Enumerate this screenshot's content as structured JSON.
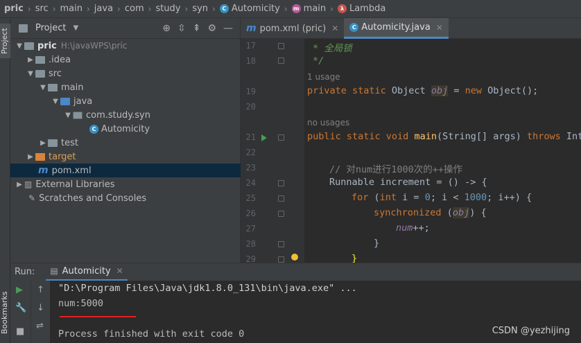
{
  "breadcrumb": {
    "items": [
      "pric",
      "src",
      "main",
      "java",
      "com",
      "study",
      "syn",
      "Automicity",
      "main",
      "Lambda"
    ]
  },
  "left_strip": {
    "project_tab": "Project",
    "bookmarks_tab": "Bookmarks"
  },
  "project_panel": {
    "title": "Project",
    "tree": [
      {
        "label": "pric",
        "extra": "H:\\javaWPS\\pric"
      },
      {
        "label": ".idea"
      },
      {
        "label": "src"
      },
      {
        "label": "main"
      },
      {
        "label": "java"
      },
      {
        "label": "com.study.syn"
      },
      {
        "label": "Automicity"
      },
      {
        "label": "test"
      },
      {
        "label": "target"
      },
      {
        "label": "pom.xml"
      },
      {
        "label": "External Libraries"
      },
      {
        "label": "Scratches and Consoles"
      }
    ]
  },
  "editor_tabs": [
    {
      "label": "pom.xml (pric)"
    },
    {
      "label": "Automicity.java"
    }
  ],
  "editor": {
    "line_numbers": [
      "17",
      "18",
      "19",
      "20",
      "21",
      "22",
      "23",
      "24",
      "25",
      "26",
      "27",
      "28",
      "29"
    ],
    "hints": {
      "usage1": "1 usage",
      "usage2": "no usages"
    },
    "lines": {
      "l17": "* 全局锁",
      "l18": "*/",
      "l19_kw": "private static ",
      "l19_type": "Object ",
      "l19_field": "obj",
      "l19_rest1": " = ",
      "l19_new": "new ",
      "l19_rest2": "Object();",
      "l21_kw": "public static void ",
      "l21_fn": "main",
      "l21_rest": "(String[] args) ",
      "l21_throws": "throws ",
      "l21_tail": "Inte",
      "l23": "// 对num进行1000次的++操作",
      "l24": "Runnable increment = () -> {",
      "l25_for": "for ",
      "l25_p1": "(",
      "l25_int": "int ",
      "l25_p2": "i = ",
      "l25_n0": "0",
      "l25_p3": "; i < ",
      "l25_n1000": "1000",
      "l25_p4": "; i++) {",
      "l26_sync": "synchronized ",
      "l26_p1": "(",
      "l26_obj": "obj",
      "l26_p2": ") {",
      "l27_num": "num",
      "l27_rest": "++;",
      "l28": "}",
      "l29": "}"
    }
  },
  "run_panel": {
    "label": "Run:",
    "tab": "Automicity",
    "console": {
      "line1": "\"D:\\Program Files\\Java\\jdk1.8.0_131\\bin\\java.exe\" ...",
      "line2": "num:5000",
      "line3": "Process finished with exit code 0"
    }
  },
  "watermark": "CSDN @yezhijing",
  "colors": {
    "accent": "#4a88c7",
    "underline": "#e02020"
  }
}
